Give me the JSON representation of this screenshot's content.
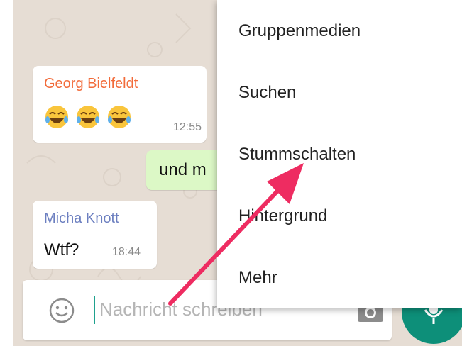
{
  "messages": [
    {
      "sender": "Georg Bielfeldt",
      "sender_color": "#f26b3a",
      "emoji_count": 3,
      "time": "12:55"
    },
    {
      "text": "und m",
      "outgoing": true
    },
    {
      "sender": "Micha Knott",
      "sender_color": "#6c7fc0",
      "text": "Wtf?",
      "time": "18:44"
    }
  ],
  "input": {
    "placeholder": "Nachricht schreiben"
  },
  "menu": {
    "items": [
      "Gruppenmedien",
      "Suchen",
      "Stummschalten",
      "Hintergrund",
      "Mehr"
    ]
  },
  "colors": {
    "accent": "#0d8f79",
    "annotation_arrow": "#ee2c61",
    "chat_background": "#e6ddd4"
  },
  "icons": [
    "emoji-icon",
    "camera-icon",
    "microphone-icon",
    "laughing-emoji-icon"
  ]
}
